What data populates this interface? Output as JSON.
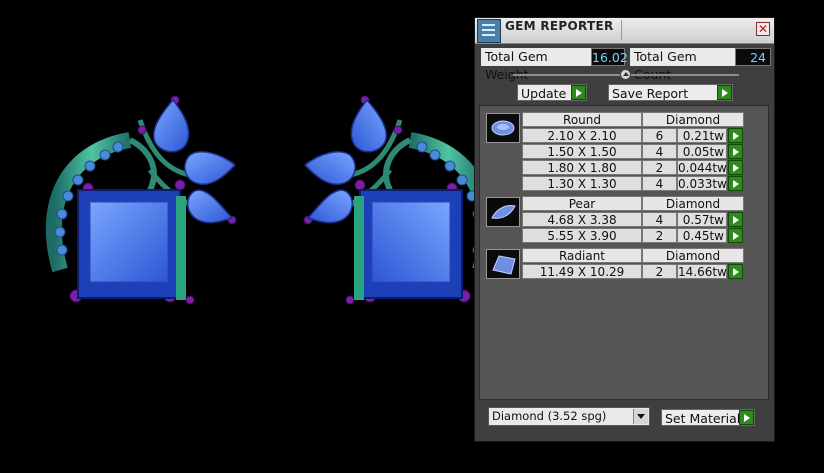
{
  "panel": {
    "title": "GEM REPORTER",
    "close_glyph": "✕",
    "total_weight_label": "Total Gem Weight",
    "total_weight_value": "16.02",
    "total_count_label": "Total Gem Count",
    "total_count_value": "24",
    "update_label": "Update",
    "save_report_label": "Save Report",
    "material_select_value": "Diamond     (3.52 spg)",
    "set_material_label": "Set Material"
  },
  "gem_groups": [
    {
      "shape": "Round",
      "material": "Diamond",
      "icon": "round-gem-icon",
      "rows": [
        {
          "size": "2.10 X 2.10",
          "count": "6",
          "weight": "0.21tw"
        },
        {
          "size": "1.50 X 1.50",
          "count": "4",
          "weight": "0.05tw"
        },
        {
          "size": "1.80 X 1.80",
          "count": "2",
          "weight": "0.044tw"
        },
        {
          "size": "1.30 X 1.30",
          "count": "4",
          "weight": "0.033tw"
        }
      ]
    },
    {
      "shape": "Pear",
      "material": "Diamond",
      "icon": "pear-gem-icon",
      "rows": [
        {
          "size": "4.68 X 3.38",
          "count": "4",
          "weight": "0.57tw"
        },
        {
          "size": "5.55 X 3.90",
          "count": "2",
          "weight": "0.45tw"
        }
      ]
    },
    {
      "shape": "Radiant",
      "material": "Diamond",
      "icon": "radiant-gem-icon",
      "rows": [
        {
          "size": "11.49 X 10.29",
          "count": "2",
          "weight": "14.66tw"
        }
      ]
    }
  ],
  "colors": {
    "panel_bg": "#3f3f3f",
    "value_text": "#6fd7ff",
    "play_green": "#2e8a1d",
    "gem_blue": "#2f5fd8",
    "metal_green": "#3aa37a",
    "accent_purple": "#7a1fa8"
  }
}
